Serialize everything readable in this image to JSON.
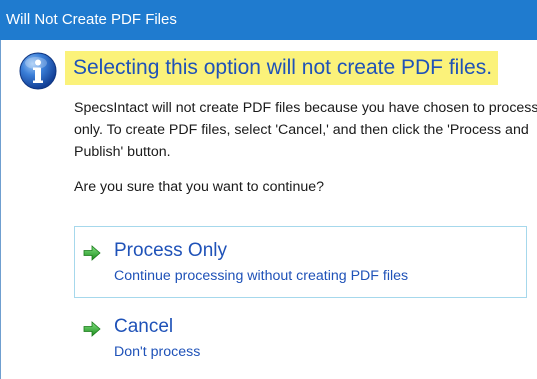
{
  "window": {
    "title": "Will Not Create PDF Files"
  },
  "message": {
    "icon": "info-icon",
    "heading": "Selecting this option will not create PDF files.",
    "body_line1": "SpecsIntact will not create PDF files because you have chosen to process",
    "body_line2": "only.  To create PDF files, select 'Cancel,' and then click the 'Process and",
    "body_line3": "Publish' button.",
    "question": "Are you sure that you want to continue?"
  },
  "commands": [
    {
      "icon": "green-arrow-icon",
      "title": "Process Only",
      "description": "Continue processing without creating PDF files",
      "focused": true
    },
    {
      "icon": "green-arrow-icon",
      "title": "Cancel",
      "description": "Don't process",
      "focused": false
    }
  ],
  "colors": {
    "titlebar": "#1f7bcf",
    "heading_highlight": "#fbf27a",
    "heading_text": "#1f52b8",
    "command_text": "#1f52b8",
    "focus_border": "#a6d8ec",
    "arrow": "#2aa52a"
  }
}
